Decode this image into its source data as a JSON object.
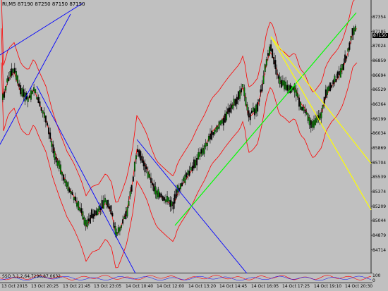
{
  "chart": {
    "title": "RI,M5  87190 87250 87150 87150",
    "current_price": "87150",
    "price_scale": [
      "87354",
      "87185",
      "87024",
      "86859",
      "86694",
      "86529",
      "86364",
      "86199",
      "86034",
      "85869",
      "85704",
      "85539",
      "85374",
      "85209",
      "85044",
      "84879",
      "84714"
    ],
    "time_labels": [
      "13 Oct 2015",
      "13 Oct 20:25",
      "13 Oct 21:45",
      "13 Oct 23:05",
      "14 Oct 10:40",
      "14 Oct 12:00",
      "14 Oct 13:20",
      "14 Oct 14:45",
      "14 Oct 16:05",
      "14 Oct 17:25",
      "14 Oct 19:10",
      "14 Oct 20:30"
    ],
    "oscillator": {
      "title": "SSO 3,1,2,64,7296,87,0632",
      "scale": [
        "100",
        "0"
      ]
    },
    "colors": {
      "background": "#c0c0c0",
      "bull_candle": "#008000",
      "bear_candle": "#000000",
      "bands": "#ff0000",
      "trend_blue": "#0000ff",
      "trend_green": "#00ff00",
      "trend_yellow": "#ffff00"
    }
  }
}
